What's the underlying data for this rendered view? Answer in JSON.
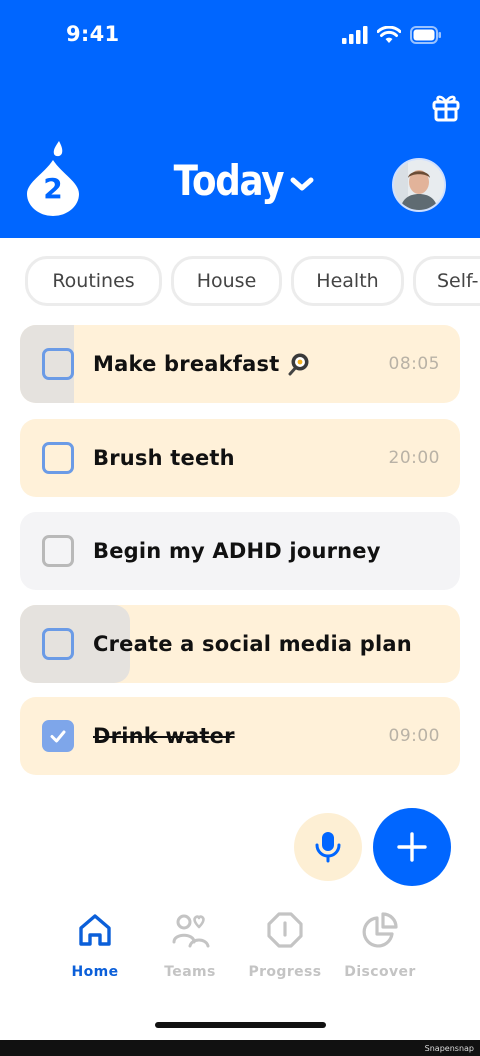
{
  "status_bar": {
    "time": "9:41"
  },
  "header": {
    "streak_count": "2",
    "title": "Today"
  },
  "filters": [
    "Routines",
    "House",
    "Health",
    "Self-"
  ],
  "tasks": [
    {
      "label": "Make breakfast",
      "emoji": "🍳",
      "time": "08:05",
      "checked": false
    },
    {
      "label": "Brush teeth",
      "time": "20:00",
      "checked": false
    },
    {
      "label": "Begin my ADHD journey",
      "time": "",
      "checked": false
    },
    {
      "label": "Create a social media plan",
      "time": "",
      "checked": false
    },
    {
      "label": "Drink water",
      "time": "09:00",
      "checked": true
    }
  ],
  "nav": [
    {
      "label": "Home",
      "icon": "home-icon",
      "active": true
    },
    {
      "label": "Teams",
      "icon": "teams-icon",
      "active": false
    },
    {
      "label": "Progress",
      "icon": "progress-icon",
      "active": false
    },
    {
      "label": "Discover",
      "icon": "discover-icon",
      "active": false
    }
  ],
  "colors": {
    "brand_blue": "#0066ff",
    "task_cream": "#fff1d9",
    "task_gray": "#f4f4f6",
    "checkbox_blue": "#6b9be6"
  },
  "watermark": "Snapensnap"
}
